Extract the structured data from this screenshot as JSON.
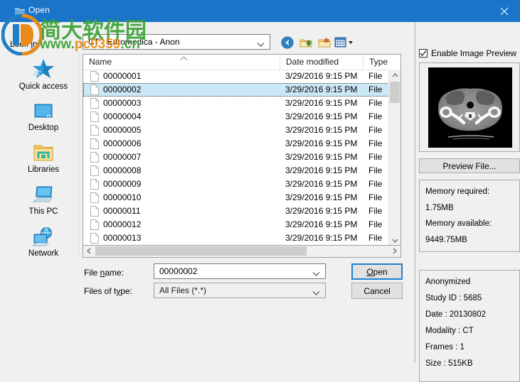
{
  "window": {
    "title": "Open",
    "title_icon": "folder-icon",
    "close_icon": "close-icon",
    "accent_color": "#1a74c8"
  },
  "watermark": {
    "cn_text": "简大软件园",
    "url_prefix": "www.",
    "url_main": "pc0359",
    "url_suffix": ".cn",
    "color": "#3aa435",
    "accent_color": "#e98b1a"
  },
  "lookin": {
    "label_pre": "Look ",
    "label_underline": "i",
    "label_post": "n:",
    "value": "CT - Euromedica - Anon",
    "arrow_icon": "chevron-down-icon"
  },
  "toolbar": [
    {
      "name": "back-button",
      "icon": "back-arrow-icon"
    },
    {
      "name": "up-one-level-button",
      "icon": "up-folder-icon"
    },
    {
      "name": "new-folder-button",
      "icon": "new-folder-icon"
    },
    {
      "name": "views-button",
      "icon": "views-icon"
    }
  ],
  "places": [
    {
      "label": "Quick access",
      "icon": "star-icon"
    },
    {
      "label": "Desktop",
      "icon": "desktop-icon"
    },
    {
      "label": "Libraries",
      "icon": "libraries-folder-icon"
    },
    {
      "label": "This PC",
      "icon": "this-pc-icon"
    },
    {
      "label": "Network",
      "icon": "network-globe-icon"
    }
  ],
  "file_list": {
    "columns": [
      "Name",
      "Date modified",
      "Type"
    ],
    "sort_column": "Name",
    "sort_direction": "ascending",
    "sort_icon": "chevron-up-icon",
    "selected_index": 1,
    "rows": [
      {
        "name": "00000001",
        "date": "3/29/2016 9:15 PM",
        "type": "File"
      },
      {
        "name": "00000002",
        "date": "3/29/2016 9:15 PM",
        "type": "File"
      },
      {
        "name": "00000003",
        "date": "3/29/2016 9:15 PM",
        "type": "File"
      },
      {
        "name": "00000004",
        "date": "3/29/2016 9:15 PM",
        "type": "File"
      },
      {
        "name": "00000005",
        "date": "3/29/2016 9:15 PM",
        "type": "File"
      },
      {
        "name": "00000006",
        "date": "3/29/2016 9:15 PM",
        "type": "File"
      },
      {
        "name": "00000007",
        "date": "3/29/2016 9:15 PM",
        "type": "File"
      },
      {
        "name": "00000008",
        "date": "3/29/2016 9:15 PM",
        "type": "File"
      },
      {
        "name": "00000009",
        "date": "3/29/2016 9:15 PM",
        "type": "File"
      },
      {
        "name": "00000010",
        "date": "3/29/2016 9:15 PM",
        "type": "File"
      },
      {
        "name": "00000011",
        "date": "3/29/2016 9:15 PM",
        "type": "File"
      },
      {
        "name": "00000012",
        "date": "3/29/2016 9:15 PM",
        "type": "File"
      },
      {
        "name": "00000013",
        "date": "3/29/2016 9:15 PM",
        "type": "File"
      }
    ]
  },
  "form": {
    "filename_label_pre": "File ",
    "filename_label_underline": "n",
    "filename_label_post": "ame:",
    "filename_value": "00000002",
    "filetype_label_pre": "Files of t",
    "filetype_label_underline": "y",
    "filetype_label_post": "pe:",
    "filetype_value": "All Files (*.*)",
    "open_button_pre": "",
    "open_button_underline": "O",
    "open_button_post": "pen",
    "cancel_button": "Cancel"
  },
  "preview": {
    "checkbox_label": "Enable Image Preview",
    "checkbox_checked": true,
    "check_icon": "check-icon",
    "preview_button": "Preview File...",
    "image_alt": "ct-scan-axial-thorax"
  },
  "memory": {
    "required_label": "Memory required:",
    "required_value": "1.75MB",
    "available_label": "Memory available:",
    "available_value": "9449.75MB"
  },
  "metadata": {
    "anonymized": "Anonymized",
    "study_id": "Study ID : 5685",
    "date": "Date : 20130802",
    "modality": "Modality : CT",
    "frames": "Frames : 1",
    "size": "Size : 515KB"
  }
}
